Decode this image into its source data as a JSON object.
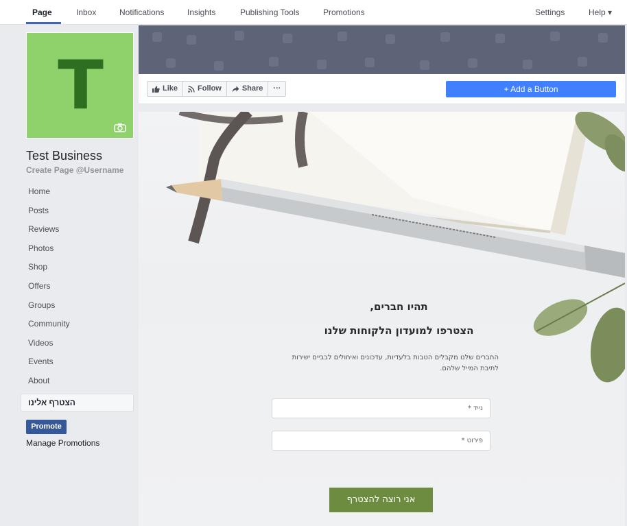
{
  "topnav": {
    "tabs": [
      "Page",
      "Inbox",
      "Notifications",
      "Insights",
      "Publishing Tools",
      "Promotions"
    ],
    "settings": "Settings",
    "help": "Help ▾"
  },
  "profile": {
    "letter": "T"
  },
  "business": {
    "name": "Test Business",
    "username": "Create Page @Username"
  },
  "sidebar": {
    "items": [
      "Home",
      "Posts",
      "Reviews",
      "Photos",
      "Shop",
      "Offers",
      "Groups",
      "Community",
      "Videos",
      "Events",
      "About",
      "הצטרף אלינו"
    ],
    "promote": "Promote",
    "manage": "Manage Promotions"
  },
  "actions": {
    "like": "Like",
    "follow": "Follow",
    "share": "Share",
    "more": "···",
    "add_button": "+ Add a Button"
  },
  "form": {
    "heading1": "תהיו חברים,",
    "heading2": "הצטרפו למועדון הלקוחות שלנו",
    "description": "החברים שלנו מקבלים הטבות בלעדיות, עדכונים ואיחולים לבביים ישירות לתיבת המייל שלהם.",
    "phone_placeholder": "נייד *",
    "name_placeholder": "פירוט *",
    "submit": "אני רוצה להצטרף"
  },
  "colors": {
    "accent": "#4267b2",
    "add_button": "#4080ff",
    "promote": "#365899",
    "profile_bg": "#8fd16b",
    "submit": "#6d8c3f"
  }
}
